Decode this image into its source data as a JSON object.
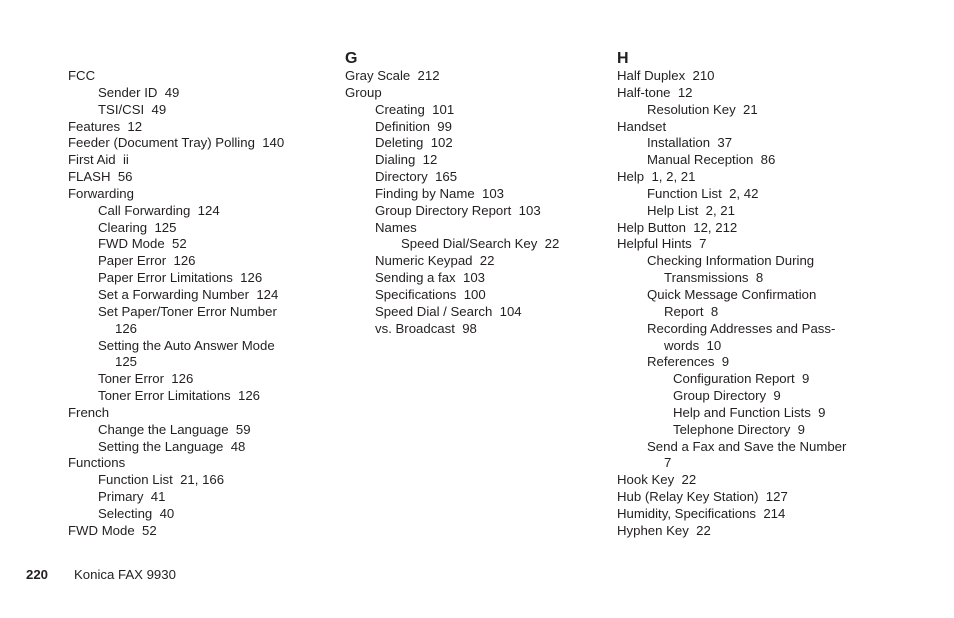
{
  "document": {
    "type": "book-index",
    "page_number": "220",
    "footer_title": "Konica FAX 9930",
    "text_color": "#231f20",
    "background_color": "#ffffff"
  },
  "columns": [
    {
      "id": "column-1",
      "heading": "",
      "entries": [
        {
          "level": 0,
          "text": "FCC"
        },
        {
          "level": 1,
          "text": "Sender ID  49"
        },
        {
          "level": 1,
          "text": "TSI/CSI  49"
        },
        {
          "level": 0,
          "text": "Features  12"
        },
        {
          "level": 0,
          "text": "Feeder (Document Tray) Polling  140"
        },
        {
          "level": 0,
          "text": "First Aid  ii"
        },
        {
          "level": 0,
          "text": "FLASH  56"
        },
        {
          "level": 0,
          "text": "Forwarding"
        },
        {
          "level": 1,
          "text": "Call Forwarding  124"
        },
        {
          "level": 1,
          "text": "Clearing  125"
        },
        {
          "level": 1,
          "text": "FWD Mode  52"
        },
        {
          "level": 1,
          "text": "Paper Error  126"
        },
        {
          "level": 1,
          "text": "Paper Error Limitations  126"
        },
        {
          "level": 1,
          "text": "Set a Forwarding Number  124"
        },
        {
          "level": 1,
          "text": "Set Paper/Toner Error Number",
          "continuation": "126"
        },
        {
          "level": 1,
          "text": "Setting the Auto Answer Mode",
          "continuation": "125"
        },
        {
          "level": 1,
          "text": "Toner Error  126"
        },
        {
          "level": 1,
          "text": "Toner Error Limitations  126"
        },
        {
          "level": 0,
          "text": "French"
        },
        {
          "level": 1,
          "text": "Change the Language  59"
        },
        {
          "level": 1,
          "text": "Setting the Language  48"
        },
        {
          "level": 0,
          "text": "Functions"
        },
        {
          "level": 1,
          "text": "Function List  21, 166"
        },
        {
          "level": 1,
          "text": "Primary  41"
        },
        {
          "level": 1,
          "text": "Selecting  40"
        },
        {
          "level": 0,
          "text": "FWD Mode  52"
        }
      ]
    },
    {
      "id": "column-2",
      "heading": "G",
      "entries": [
        {
          "level": 0,
          "text": "Gray Scale  212"
        },
        {
          "level": 0,
          "text": "Group"
        },
        {
          "level": 1,
          "text": "Creating  101"
        },
        {
          "level": 1,
          "text": "Definition  99"
        },
        {
          "level": 1,
          "text": "Deleting  102"
        },
        {
          "level": 1,
          "text": "Dialing  12"
        },
        {
          "level": 1,
          "text": "Directory  165"
        },
        {
          "level": 1,
          "text": "Finding by Name  103"
        },
        {
          "level": 1,
          "text": "Group Directory Report  103"
        },
        {
          "level": 1,
          "text": "Names"
        },
        {
          "level": 2,
          "text": "Speed Dial/Search Key  22"
        },
        {
          "level": 1,
          "text": "Numeric Keypad  22"
        },
        {
          "level": 1,
          "text": "Sending a fax  103"
        },
        {
          "level": 1,
          "text": "Specifications  100"
        },
        {
          "level": 1,
          "text": "Speed Dial / Search  104"
        },
        {
          "level": 1,
          "text": "vs. Broadcast  98"
        }
      ]
    },
    {
      "id": "column-3",
      "heading": "H",
      "entries": [
        {
          "level": 0,
          "text": "Half Duplex  210"
        },
        {
          "level": 0,
          "text": "Half-tone  12"
        },
        {
          "level": 1,
          "text": "Resolution Key  21"
        },
        {
          "level": 0,
          "text": "Handset"
        },
        {
          "level": 1,
          "text": "Installation  37"
        },
        {
          "level": 1,
          "text": "Manual Reception  86"
        },
        {
          "level": 0,
          "text": "Help  1, 2, 21"
        },
        {
          "level": 1,
          "text": "Function List  2, 42"
        },
        {
          "level": 1,
          "text": "Help List  2, 21"
        },
        {
          "level": 0,
          "text": "Help Button  12, 212"
        },
        {
          "level": 0,
          "text": "Helpful Hints  7"
        },
        {
          "level": 1,
          "text": "Checking Information During",
          "continuation": "Transmissions  8"
        },
        {
          "level": 1,
          "text": "Quick Message Confirmation",
          "continuation": "Report  8"
        },
        {
          "level": 1,
          "text": "Recording Addresses and Pass-",
          "continuation": "words  10"
        },
        {
          "level": 1,
          "text": "References  9"
        },
        {
          "level": 2,
          "text": "Configuration Report  9"
        },
        {
          "level": 2,
          "text": "Group Directory  9"
        },
        {
          "level": 2,
          "text": "Help and Function Lists  9"
        },
        {
          "level": 2,
          "text": "Telephone Directory  9"
        },
        {
          "level": 1,
          "text": "Send a Fax and Save the Number",
          "continuation": "7"
        },
        {
          "level": 0,
          "text": "Hook Key  22"
        },
        {
          "level": 0,
          "text": "Hub (Relay Key Station)  127"
        },
        {
          "level": 0,
          "text": "Humidity, Specifications  214"
        },
        {
          "level": 0,
          "text": "Hyphen Key  22"
        }
      ]
    }
  ]
}
